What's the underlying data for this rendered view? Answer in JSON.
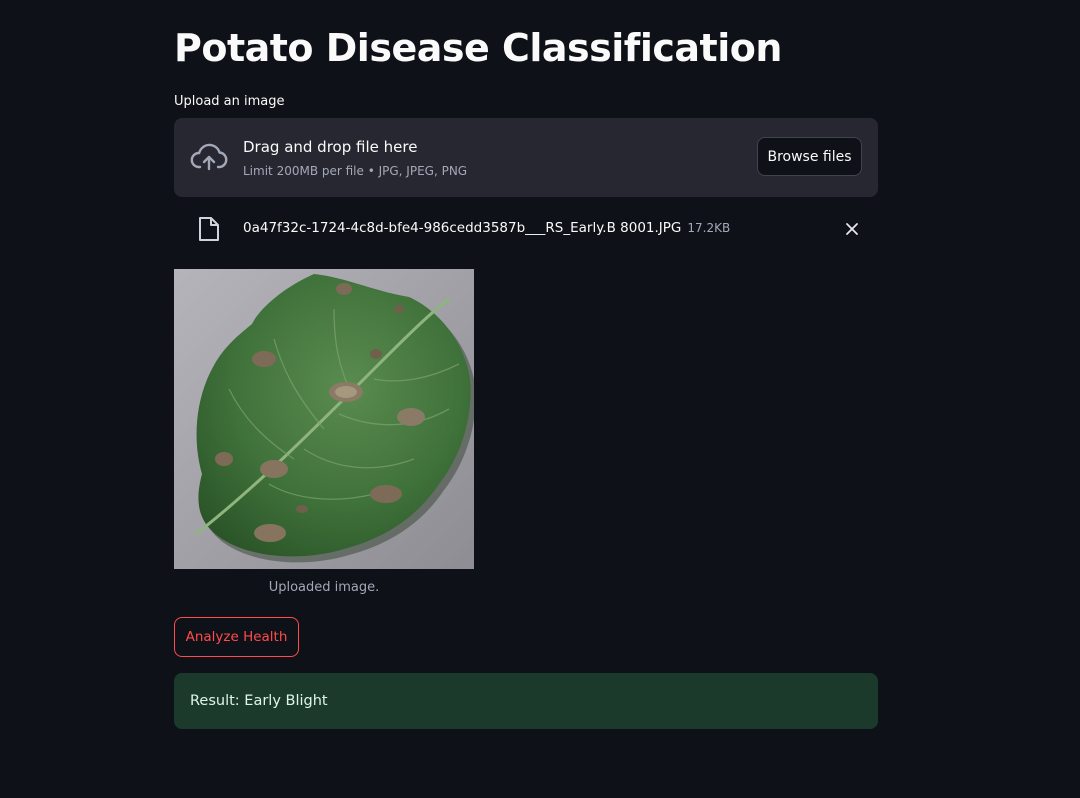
{
  "page": {
    "title": "Potato Disease Classification"
  },
  "uploader": {
    "label": "Upload an image",
    "drop_text": "Drag and drop file here",
    "limit_text": "Limit 200MB per file • JPG, JPEG, PNG",
    "browse_label": "Browse files",
    "cloud_icon": "cloud-upload-icon"
  },
  "file": {
    "name": "0a47f32c-1724-4c8d-bfe4-986cedd3587b___RS_Early.B 8001.JPG",
    "size": "17.2KB",
    "file_icon": "file-icon",
    "remove_icon": "close-icon"
  },
  "image": {
    "caption": "Uploaded image."
  },
  "actions": {
    "analyze_label": "Analyze Health"
  },
  "result": {
    "text": "Result: Early Blight"
  },
  "colors": {
    "background": "#0e1117",
    "dropzone": "#262730",
    "accent": "#ff4b4b",
    "success_bg": "#1b3a2b"
  }
}
